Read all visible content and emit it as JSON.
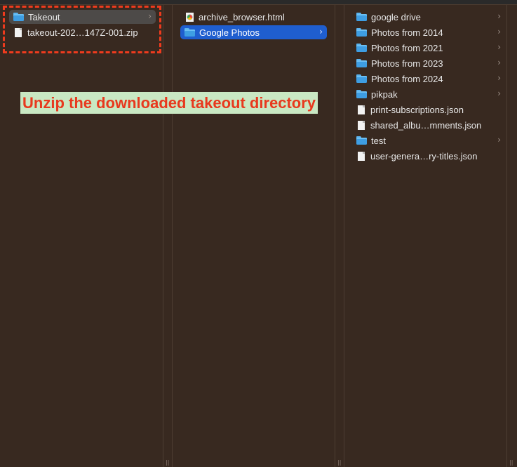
{
  "columns": [
    {
      "items": [
        {
          "type": "folder",
          "label": "Takeout",
          "has_children": true,
          "selected": "gray"
        },
        {
          "type": "file",
          "label": "takeout-202…147Z-001.zip",
          "has_children": false
        }
      ]
    },
    {
      "items": [
        {
          "type": "html-file",
          "label": "archive_browser.html",
          "has_children": false
        },
        {
          "type": "folder",
          "label": "Google Photos",
          "has_children": true,
          "selected": "blue"
        }
      ]
    },
    {
      "items": [
        {
          "type": "folder",
          "label": "google drive",
          "has_children": true
        },
        {
          "type": "folder",
          "label": "Photos from 2014",
          "has_children": true
        },
        {
          "type": "folder",
          "label": "Photos from 2021",
          "has_children": true
        },
        {
          "type": "folder",
          "label": "Photos from 2023",
          "has_children": true
        },
        {
          "type": "folder",
          "label": "Photos from 2024",
          "has_children": true
        },
        {
          "type": "folder",
          "label": "pikpak",
          "has_children": true
        },
        {
          "type": "file",
          "label": "print-subscriptions.json",
          "has_children": false
        },
        {
          "type": "file",
          "label": "shared_albu…mments.json",
          "has_children": false
        },
        {
          "type": "folder",
          "label": "test",
          "has_children": true
        },
        {
          "type": "file",
          "label": "user-genera…ry-titles.json",
          "has_children": false
        }
      ]
    }
  ],
  "annotation": {
    "text": "Unzip the downloaded takeout directory",
    "text_color": "#e8391e",
    "background_color": "#c9e8c3",
    "box_color": "#ee3b1e"
  },
  "chevron_glyph": "›",
  "divider_grip_glyph": "||",
  "colors": {
    "background": "#3a2b22",
    "selection_blue": "#1f5ecf",
    "selection_gray": "#4d4a48",
    "folder": "#3e9ee3"
  }
}
